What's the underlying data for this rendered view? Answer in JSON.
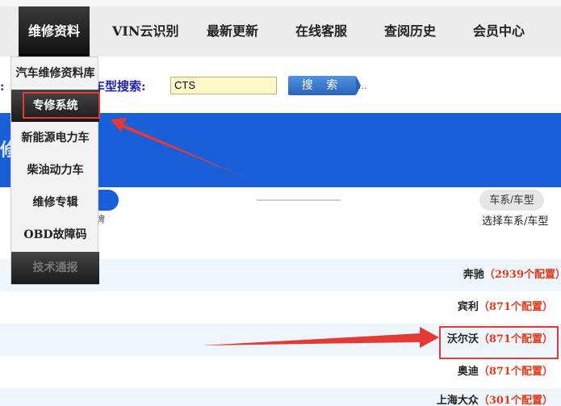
{
  "nav": {
    "active": "维修资料",
    "items": [
      "VIN云识别",
      "最新更新",
      "在线客服",
      "查阅历史",
      "会员中心"
    ]
  },
  "dropdown": {
    "items": [
      "汽车维修资料库",
      "专修系统",
      "新能源电力车",
      "柴油动力车",
      "维修专辑",
      "OBD故障码",
      "技术通报"
    ]
  },
  "search": {
    "prefix": ":（",
    "label": "车型搜索:",
    "value": "CTS",
    "button": "搜 索",
    "trailing": "..."
  },
  "banner": {
    "text": "修系统"
  },
  "steps": {
    "left_caption": "选择品牌",
    "right_pill": "车系/车型",
    "right_caption": "选择车系/车型"
  },
  "brands": [
    {
      "name": "奔驰",
      "count": "（2939个配置）"
    },
    {
      "name": "宾利",
      "count": "（871个配置）"
    },
    {
      "name": "沃尔沃",
      "count": "（871个配置）"
    },
    {
      "name": "奥迪",
      "count": "（871个配置）"
    },
    {
      "name": "上海大众",
      "count": "（301个配置）"
    }
  ],
  "colors": {
    "nav_bg": "#ececec",
    "accent_blue": "#1a5fd8",
    "highlight_red": "#e53935",
    "count_red": "#e23b1c",
    "search_input_bg": "#fcf8c8"
  }
}
